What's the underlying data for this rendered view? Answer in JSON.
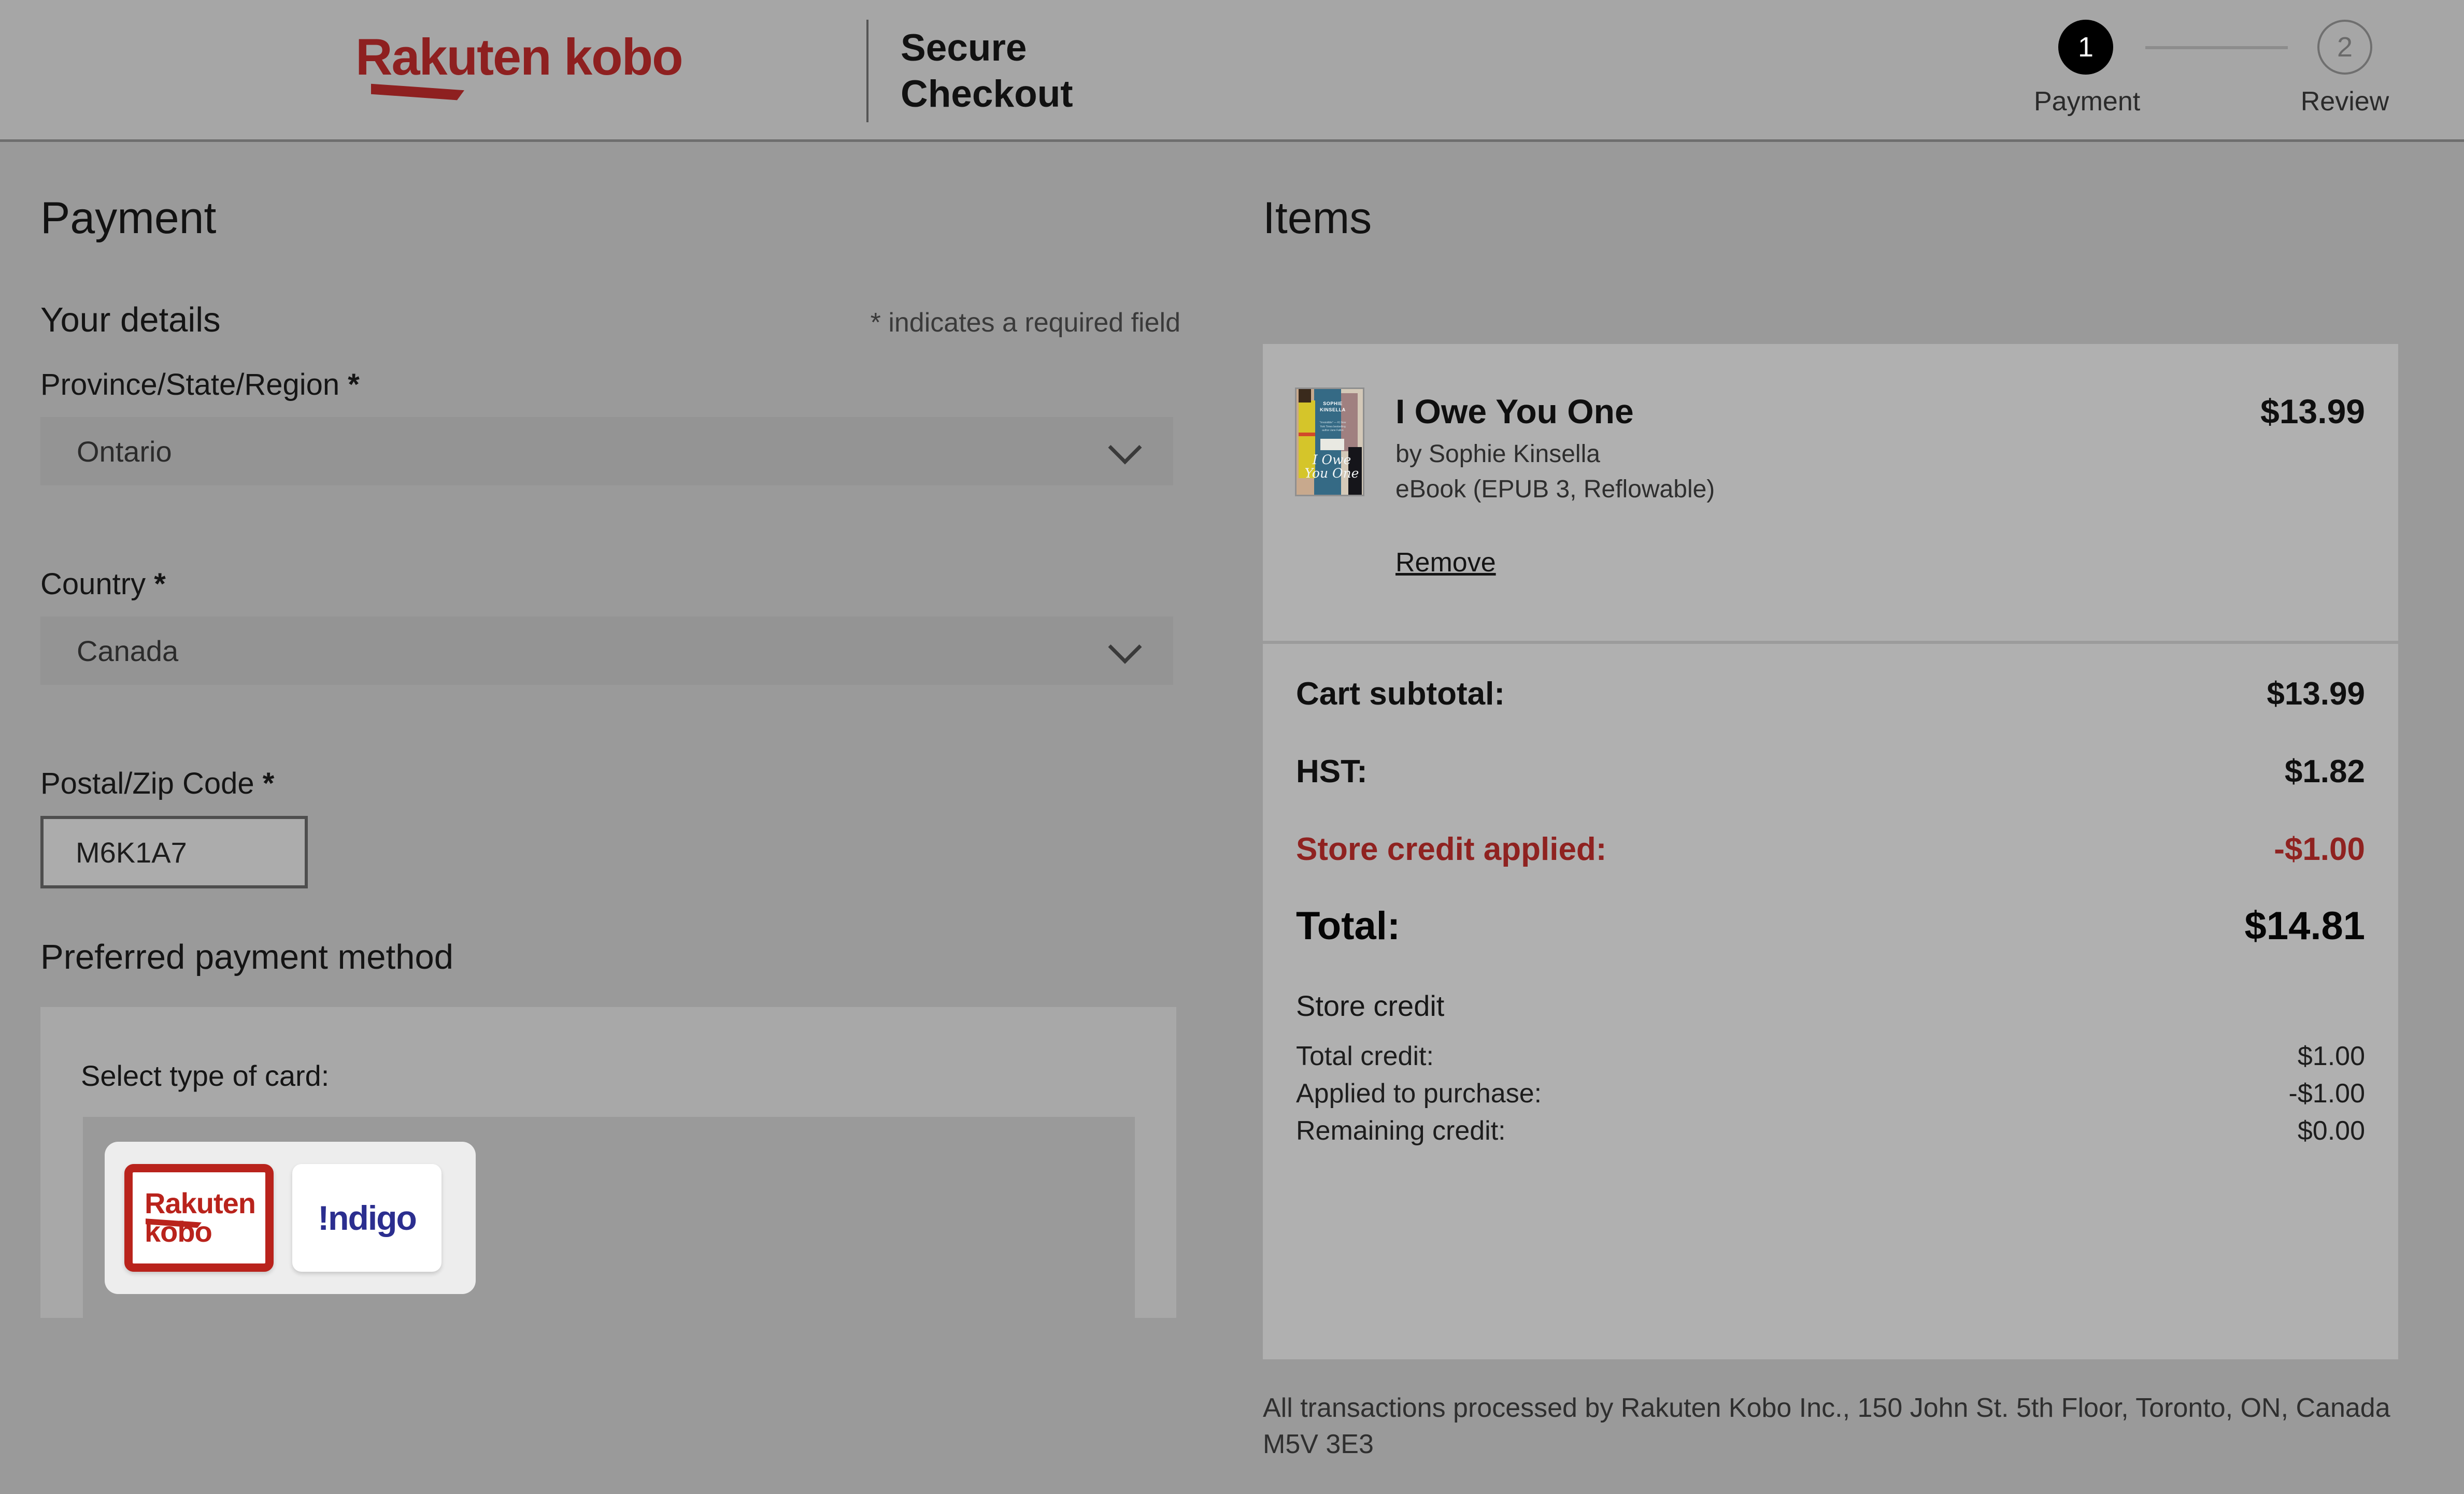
{
  "header": {
    "logo_line1": "Rakuten",
    "logo_line2": "kobo",
    "logo_text": "Rakuten kobo",
    "title_line1": "Secure",
    "title_line2": "Checkout",
    "brand_color": "#8e2020",
    "steps": [
      {
        "number": "1",
        "label": "Payment",
        "state": "active"
      },
      {
        "number": "2",
        "label": "Review",
        "state": "inactive"
      }
    ]
  },
  "payment": {
    "section_title": "Payment",
    "your_details_title": "Your details",
    "required_note": "* indicates a required field",
    "fields": [
      {
        "label": "Province/State/Region",
        "required": "*",
        "value": "Ontario",
        "type": "select"
      },
      {
        "label": "Country",
        "required": "*",
        "value": "Canada",
        "type": "select"
      },
      {
        "label": "Postal/Zip Code",
        "required": "*",
        "value": "M6K1A7",
        "type": "text"
      }
    ],
    "preferred_method_title": "Preferred payment method",
    "select_card_label": "Select type of card:",
    "card_options": [
      {
        "name": "Rakuten kobo",
        "line1": "Rakuten",
        "line2": "kobo",
        "selected": true,
        "color": "#b9231c"
      },
      {
        "name": "!ndigo",
        "text": "!ndigo",
        "selected": false,
        "color": "#2b2e8f"
      }
    ]
  },
  "items": {
    "section_title": "Items",
    "item": {
      "title": "I Owe You One",
      "author": "by Sophie Kinsella",
      "format": "eBook (EPUB 3, Reflowable)",
      "remove_label": "Remove",
      "price": "$13.99",
      "cover": {
        "author_credit": "#1 NEW YORK TIMES BESTSELLING AUTHOR",
        "author_name_l1": "SOPHIE",
        "author_name_l2": "KINSELLA",
        "blurb": "“Irresistible” — #1 New York Times bestselling author Jane Fallon",
        "title_l1": "I Owe",
        "title_l2": "You One",
        "tagline": "A new novel of debts and do-overs"
      }
    },
    "totals": [
      {
        "label": "Cart subtotal:",
        "value": "$13.99",
        "style": "bold"
      },
      {
        "label": "HST:",
        "value": "$1.82",
        "style": "bold"
      },
      {
        "label": "Store credit applied:",
        "value": "-$1.00",
        "style": "credit"
      },
      {
        "label": "Total:",
        "value": "$14.81",
        "style": "total"
      }
    ],
    "store_credit": {
      "title": "Store credit",
      "rows": [
        {
          "label": "Total credit:",
          "value": "$1.00"
        },
        {
          "label": "Applied to purchase:",
          "value": "-$1.00"
        },
        {
          "label": "Remaining credit:",
          "value": "$0.00"
        }
      ]
    },
    "legal_note": "All transactions processed by Rakuten Kobo Inc., 150 John St. 5th Floor, Toronto, ON, Canada M5V 3E3"
  }
}
